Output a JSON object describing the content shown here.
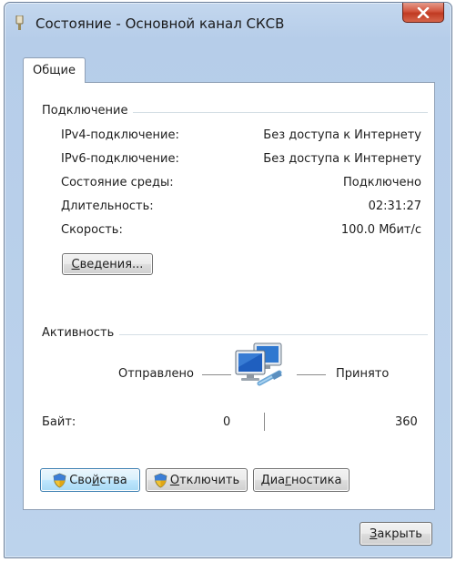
{
  "window": {
    "title": "Состояние - Основной канал СКСВ",
    "close_icon": "close-icon"
  },
  "tabs": [
    {
      "label": "Общие",
      "selected": true
    }
  ],
  "connection": {
    "header": "Подключение",
    "rows": [
      {
        "label": "IPv4-подключение:",
        "value": "Без доступа к Интернету"
      },
      {
        "label": "IPv6-подключение:",
        "value": "Без доступа к Интернету"
      },
      {
        "label": "Состояние среды:",
        "value": "Подключено"
      },
      {
        "label": "Длительность:",
        "value": "02:31:27"
      },
      {
        "label": "Скорость:",
        "value": "100.0 Мбит/с"
      }
    ],
    "details_button": {
      "underlined": "С",
      "rest": "ведения..."
    }
  },
  "activity": {
    "header": "Активность",
    "sent_label": "Отправлено",
    "received_label": "Принято",
    "bytes_label": "Байт:",
    "bytes_sent": "0",
    "bytes_received": "360",
    "icon": "network-computers-icon"
  },
  "buttons": {
    "properties": {
      "before": "Сво",
      "underlined": "й",
      "after": "ства"
    },
    "disable": {
      "before": "",
      "underlined": "О",
      "after": "тключить"
    },
    "diagnose": {
      "before": "Диа",
      "underlined": "г",
      "after": "ностика"
    },
    "close": {
      "before": "",
      "underlined": "З",
      "after": "акрыть"
    }
  },
  "colors": {
    "window_frame": "#b6cde9",
    "close_button": "#c94a32",
    "focus_border": "#3c7fb1"
  }
}
